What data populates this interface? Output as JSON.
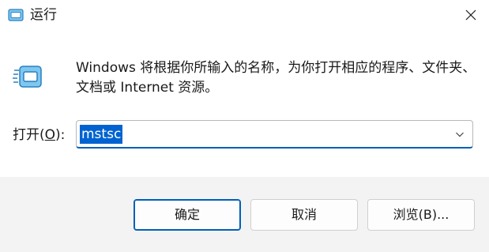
{
  "window": {
    "title": "运行"
  },
  "dialog": {
    "description": "Windows 将根据你所输入的名称，为你打开相应的程序、文件夹、文档或 Internet 资源。",
    "open_label_prefix": "打开(",
    "open_label_key": "O",
    "open_label_suffix": "):",
    "command_value": "mstsc"
  },
  "buttons": {
    "ok": "确定",
    "cancel": "取消",
    "browse": "浏览(B)..."
  },
  "icons": {
    "app": "run-icon",
    "close": "close-icon",
    "dropdown": "chevron-down-icon"
  },
  "colors": {
    "accent": "#005fb8",
    "selection": "#0063d1",
    "footer_bg": "#f3f3f3"
  }
}
